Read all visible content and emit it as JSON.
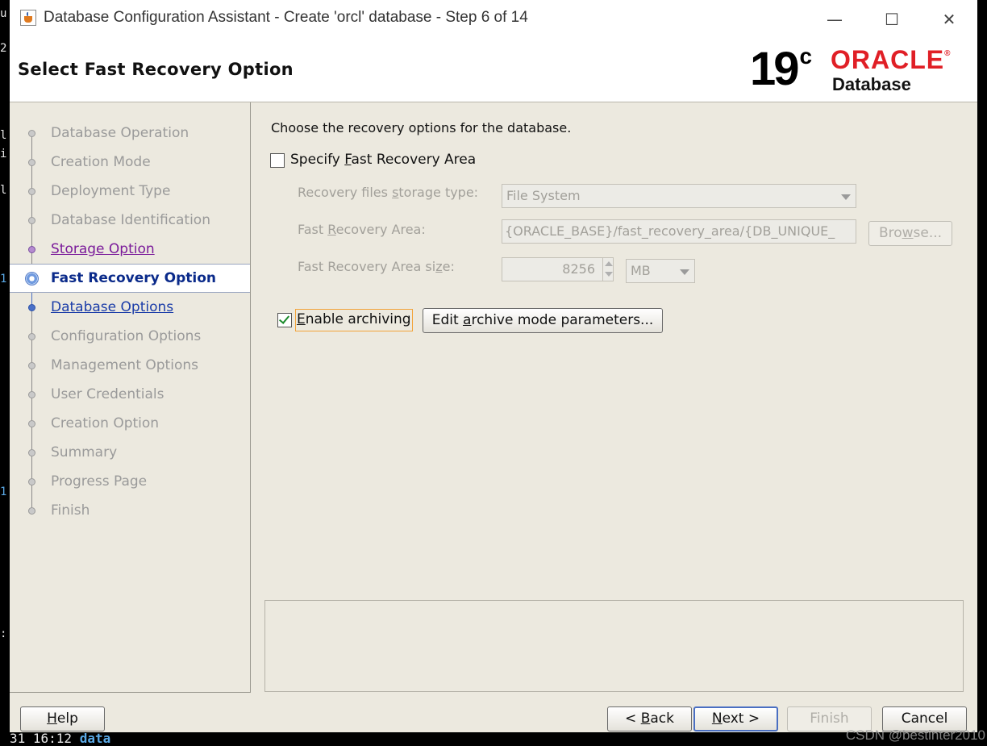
{
  "window": {
    "title": "Database Configuration Assistant - Create 'orcl' database - Step 6 of 14",
    "minimize": "—",
    "maximize": "☐",
    "close": "✕"
  },
  "header": {
    "page_title": "Select Fast Recovery Option",
    "logo_version": "19",
    "logo_version_sup": "c",
    "logo_brand": "ORACLE",
    "logo_reg": "®",
    "logo_product": "Database"
  },
  "nav": {
    "items": [
      {
        "label": "Database Operation",
        "state": "disabled"
      },
      {
        "label": "Creation Mode",
        "state": "disabled"
      },
      {
        "label": "Deployment Type",
        "state": "disabled"
      },
      {
        "label": "Database Identification",
        "state": "disabled"
      },
      {
        "label": "Storage Option",
        "state": "visited"
      },
      {
        "label": "Fast Recovery Option",
        "state": "current"
      },
      {
        "label": "Database Options",
        "state": "link"
      },
      {
        "label": "Configuration Options",
        "state": "disabled"
      },
      {
        "label": "Management Options",
        "state": "disabled"
      },
      {
        "label": "User Credentials",
        "state": "disabled"
      },
      {
        "label": "Creation Option",
        "state": "disabled"
      },
      {
        "label": "Summary",
        "state": "disabled"
      },
      {
        "label": "Progress Page",
        "state": "disabled"
      },
      {
        "label": "Finish",
        "state": "disabled"
      }
    ]
  },
  "content": {
    "intro": "Choose the recovery options for the database.",
    "specify_fra": {
      "pre": "Specify ",
      "mn": "F",
      "post": "ast Recovery Area",
      "checked": false
    },
    "storage_type": {
      "label_pre": "Recovery files ",
      "label_mn": "s",
      "label_post": "torage type:",
      "value": "File System"
    },
    "fra_path": {
      "label_pre": "Fast ",
      "label_mn": "R",
      "label_post": "ecovery Area:",
      "value": "{ORACLE_BASE}/fast_recovery_area/{DB_UNIQUE_",
      "browse_pre": "Bro",
      "browse_mn": "w",
      "browse_post": "se..."
    },
    "fra_size": {
      "label_pre": "Fast Recovery Area si",
      "label_mn": "z",
      "label_post": "e:",
      "value": "8256",
      "unit": "MB"
    },
    "archiving": {
      "mn": "E",
      "post": "nable archiving",
      "checked": true
    },
    "edit_archive": {
      "pre": "Edit ",
      "mn": "a",
      "post": "rchive mode parameters..."
    }
  },
  "footer": {
    "help": {
      "mn": "H",
      "post": "elp"
    },
    "back": {
      "pre": "< ",
      "mn": "B",
      "post": "ack"
    },
    "next": {
      "mn": "N",
      "post": "ext >"
    },
    "finish": "Finish",
    "cancel": "Cancel"
  },
  "background": {
    "term_lines": [
      "u",
      "2",
      "l",
      "i",
      "l",
      "1",
      "1",
      ":"
    ],
    "term_bottom": "31 16:12",
    "term_bottom_blue": "data"
  },
  "watermark": "CSDN @bestinter2010",
  "colors": {
    "oracle_red": "#e01f26",
    "accent_blue": "#4a6fc2",
    "archiving_focus": "#f2a33a"
  }
}
